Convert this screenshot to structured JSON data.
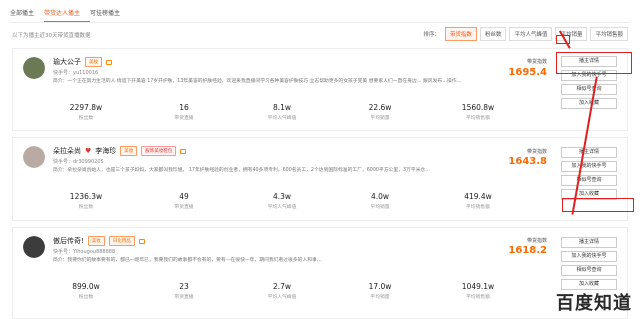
{
  "tabs": [
    "全部播主",
    "带货达人播主",
    "可挂榜播主"
  ],
  "note": "以下为播主近30天带货直播数据",
  "sort": {
    "label": "排序：",
    "options": [
      "带货指数",
      "粉丝数",
      "平均人气峰值",
      "平均销量",
      "平均销售额"
    ]
  },
  "cards": [
    {
      "name": "瑜大公子",
      "tags": [
        {
          "text": "美妆",
          "style": "orange"
        }
      ],
      "heart": "",
      "id": "快手号：yu110016",
      "intro": "简介：一个正在努力生活的人 情谊下开美容 17岁开护肤，13年美容的护肤经验。欢迎来我直播间学习各种美容护肤技巧 立志帮助更多的女孩子变美 想要家人们一直在身边…  跟风发布…操作…",
      "index_label": "带货指数",
      "index_value": "1695.4",
      "actions": [
        "播主详情",
        "加入我的快手号",
        "相似号查询",
        "加入收藏"
      ],
      "stats": [
        {
          "value": "2297.8w",
          "label": "粉丝数"
        },
        {
          "value": "16",
          "label": "带货直播"
        },
        {
          "value": "8.1w",
          "label": "平均人气峰值"
        },
        {
          "value": "22.6w",
          "label": "平均销量"
        },
        {
          "value": "1560.8w",
          "label": "平均销售额"
        }
      ],
      "avatar_color": "#6b7a55"
    },
    {
      "name": "朵拉朵尚",
      "tags": [
        {
          "text": "美妆",
          "style": "orange"
        },
        {
          "text": "服饰美妆鞋包",
          "style": "red"
        }
      ],
      "heart": "♥",
      "name2": "李海珍",
      "id": "快手号：dr30990205",
      "intro": "简介：朵拉朵尚创始人，也是三个孩子妈妈，大家都叫我珍姐。 17年护肤经验的创业者，拥有40多项专利，600名员工，2个达到国际标准的工厂，6000平方公里，3万平米仓…",
      "index_label": "带货指数",
      "index_value": "1643.8",
      "actions": [
        "播主详情",
        "加入我的快手号",
        "相似号查询",
        "加入收藏"
      ],
      "stats": [
        {
          "value": "1236.3w",
          "label": "粉丝数"
        },
        {
          "value": "49",
          "label": "带货直播"
        },
        {
          "value": "4.3w",
          "label": "平均人气峰值"
        },
        {
          "value": "4.0w",
          "label": "平均销量"
        },
        {
          "value": "419.4w",
          "label": "平均销售额"
        }
      ],
      "avatar_color": "#9a8f8a"
    },
    {
      "name": "傲后传奇!",
      "tags": [
        {
          "text": "美妆",
          "style": "orange"
        },
        {
          "text": "日化用品",
          "style": "orange"
        }
      ],
      "heart": "",
      "id": "快手号：Yihougou888888",
      "intro": "简介：我要你们的故事要有的，都已一呢年已，我要我们的故事都不会有的，要有一在很快一年，期间我们看过很多的人和事…",
      "index_label": "带货指数",
      "index_value": "1618.2",
      "actions": [
        "播主详情",
        "加入我的快手号",
        "相似号查询",
        "加入收藏"
      ],
      "stats": [
        {
          "value": "899.0w",
          "label": "粉丝数"
        },
        {
          "value": "23",
          "label": "带货直播"
        },
        {
          "value": "2.7w",
          "label": "平均人气峰值"
        },
        {
          "value": "17.0w",
          "label": "平均销量"
        },
        {
          "value": "1049.1w",
          "label": "平均销售额"
        }
      ],
      "avatar_color": "#3c3c3c"
    }
  ],
  "watermark": "百度知道",
  "colors": {
    "accent": "#ff5a1f",
    "index": "#ff6a00",
    "annotation": "#e02020"
  }
}
